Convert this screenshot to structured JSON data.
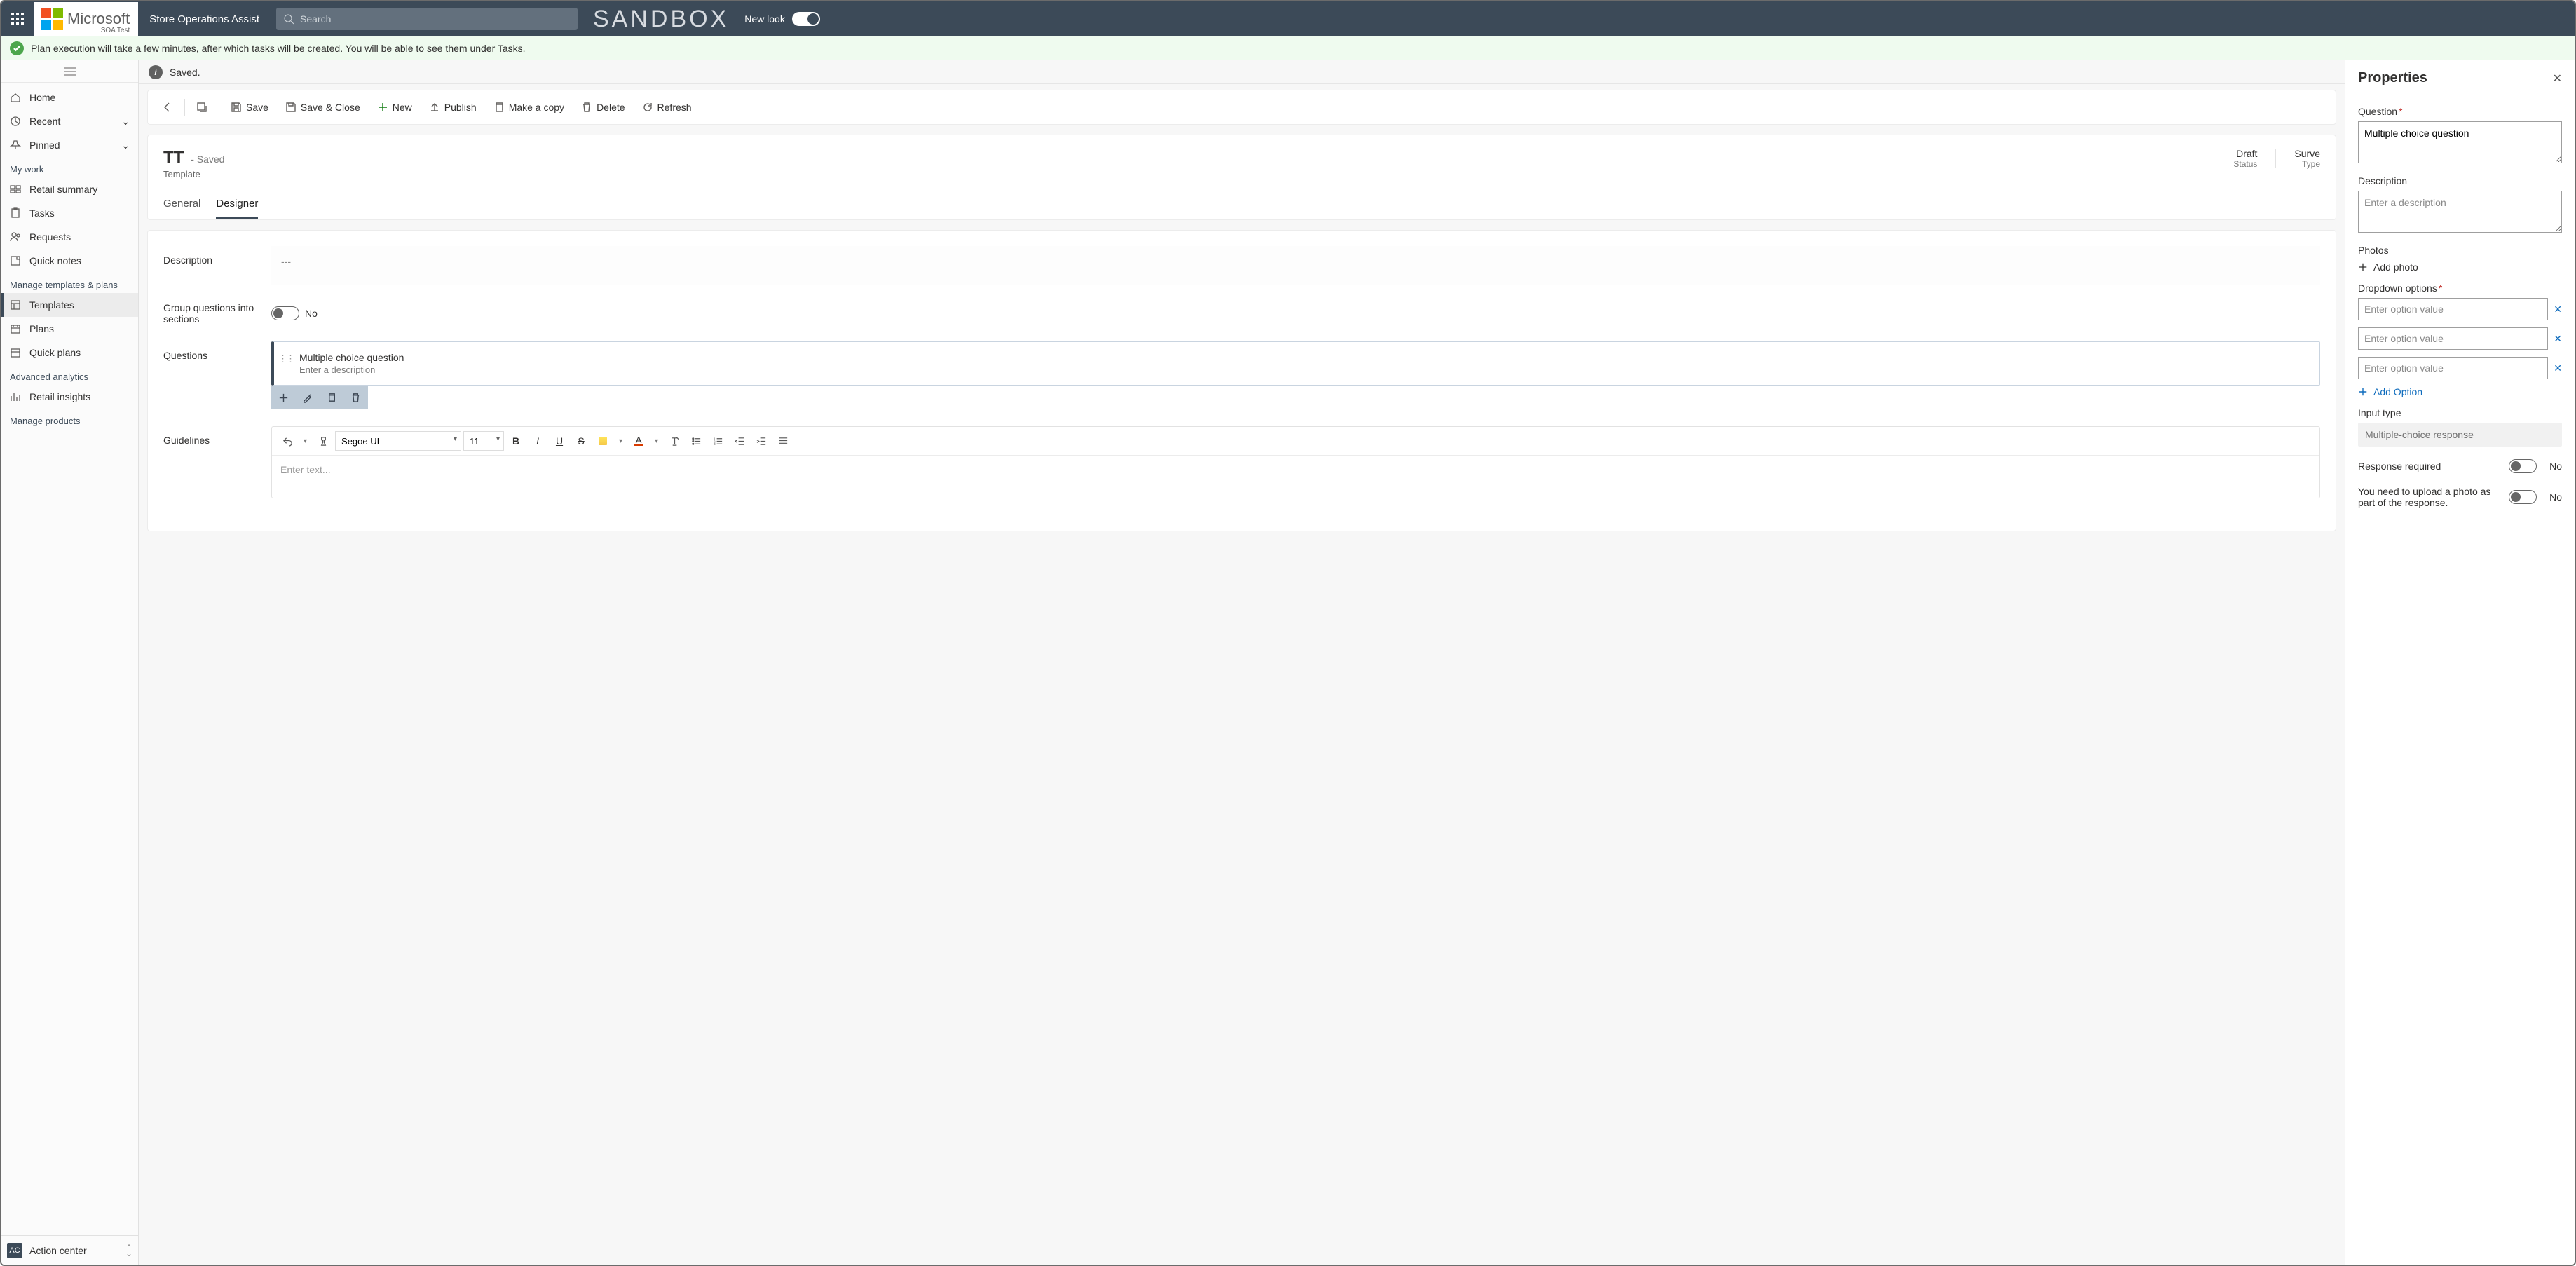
{
  "top": {
    "logo_text": "Microsoft",
    "logo_sub": "SOA Test",
    "app_title": "Store Operations Assist",
    "search_placeholder": "Search",
    "sandbox": "SANDBOX",
    "new_look": "New look"
  },
  "notification": "Plan execution will take a few minutes, after which tasks will be created. You will be able to see them under Tasks.",
  "saved_bar": "Saved.",
  "nav": {
    "home": "Home",
    "recent": "Recent",
    "pinned": "Pinned",
    "sections": {
      "mywork": "My work",
      "mywork_items": [
        "Retail summary",
        "Tasks",
        "Requests",
        "Quick notes"
      ],
      "templates": "Manage templates & plans",
      "templates_items": [
        "Templates",
        "Plans",
        "Quick plans"
      ],
      "analytics": "Advanced analytics",
      "analytics_items": [
        "Retail insights"
      ],
      "products": "Manage products"
    },
    "action_center_badge": "AC",
    "action_center": "Action center"
  },
  "cmd": {
    "save": "Save",
    "save_close": "Save & Close",
    "new": "New",
    "publish": "Publish",
    "make_copy": "Make a copy",
    "delete": "Delete",
    "refresh": "Refresh"
  },
  "record": {
    "title": "TT",
    "saved": "- Saved",
    "subtitle": "Template",
    "status_value": "Draft",
    "status_label": "Status",
    "type_value": "Surve",
    "type_label": "Type",
    "tabs": {
      "general": "General",
      "designer": "Designer"
    }
  },
  "form": {
    "description_label": "Description",
    "description_value": "---",
    "group_label": "Group questions into sections",
    "group_value": "No",
    "questions_label": "Questions",
    "question_card": {
      "title": "Multiple choice question",
      "desc": "Enter a description"
    },
    "guidelines_label": "Guidelines",
    "rte_font": "Segoe UI",
    "rte_size": "11",
    "rte_placeholder": "Enter text..."
  },
  "panel": {
    "title": "Properties",
    "q_label": "Question",
    "q_value": "Multiple choice question",
    "desc_label": "Description",
    "desc_placeholder": "Enter a description",
    "photos_label": "Photos",
    "add_photo": "Add photo",
    "dropdown_label": "Dropdown options",
    "option_placeholder": "Enter option value",
    "add_option": "Add Option",
    "input_type_label": "Input type",
    "input_type_value": "Multiple-choice response",
    "response_required": "Response required",
    "rr_value": "No",
    "upload_photo": "You need to upload a photo as part of the response.",
    "up_value": "No"
  }
}
